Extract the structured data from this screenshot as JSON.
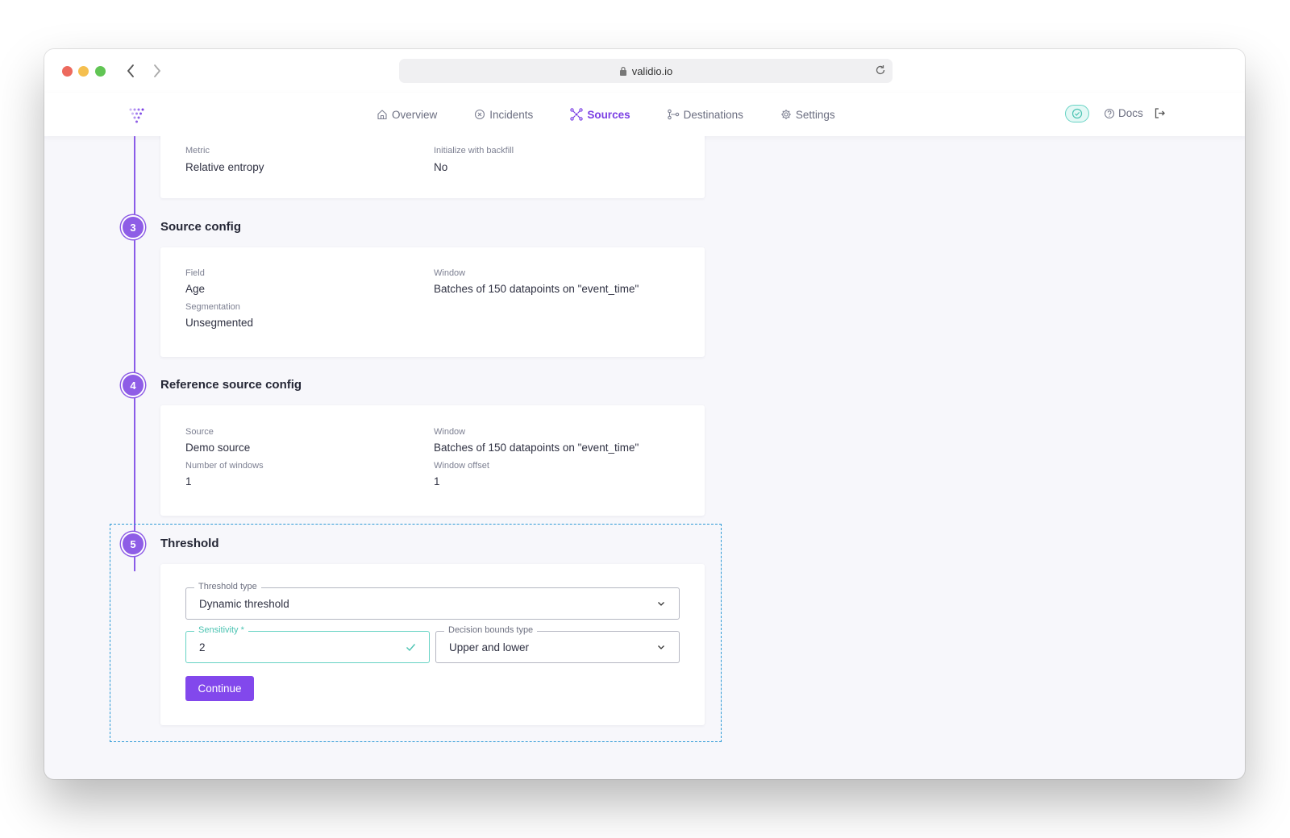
{
  "browser": {
    "url": "validio.io"
  },
  "nav": {
    "items": [
      {
        "label": "Overview",
        "icon": "home-icon"
      },
      {
        "label": "Incidents",
        "icon": "x-circle-icon"
      },
      {
        "label": "Sources",
        "icon": "network-icon",
        "active": true
      },
      {
        "label": "Destinations",
        "icon": "share-icon"
      },
      {
        "label": "Settings",
        "icon": "gear-icon"
      }
    ],
    "docs_label": "Docs"
  },
  "monitor_config": {
    "metric_label": "Metric",
    "metric_value": "Relative entropy",
    "backfill_label": "Initialize with backfill",
    "backfill_value": "No"
  },
  "steps": {
    "source_config": {
      "number": "3",
      "title": "Source config",
      "field_label": "Field",
      "field_value": "Age",
      "window_label": "Window",
      "window_value": "Batches of 150 datapoints on \"event_time\"",
      "segmentation_label": "Segmentation",
      "segmentation_value": "Unsegmented"
    },
    "reference_source_config": {
      "number": "4",
      "title": "Reference source config",
      "source_label": "Source",
      "source_value": "Demo source",
      "window_label": "Window",
      "window_value": "Batches of 150 datapoints on \"event_time\"",
      "num_windows_label": "Number of windows",
      "num_windows_value": "1",
      "window_offset_label": "Window offset",
      "window_offset_value": "1"
    },
    "threshold": {
      "number": "5",
      "title": "Threshold",
      "threshold_type_label": "Threshold type",
      "threshold_type_value": "Dynamic threshold",
      "sensitivity_label": "Sensitivity *",
      "sensitivity_value": "2",
      "decision_bounds_label": "Decision bounds type",
      "decision_bounds_value": "Upper and lower",
      "continue_label": "Continue"
    }
  },
  "colors": {
    "accent": "#8248ec",
    "valid": "#67d3c4",
    "selection": "#2e9ad6"
  }
}
